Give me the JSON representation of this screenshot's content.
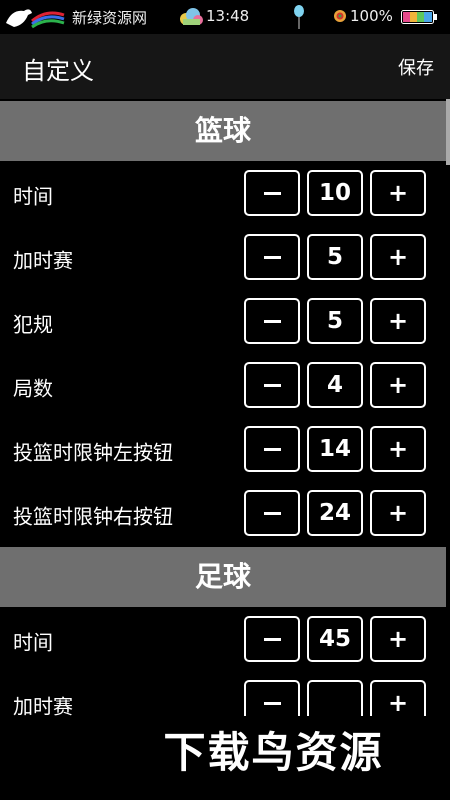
{
  "status_bar": {
    "site_name": "新绿资源网",
    "time": "13:48",
    "battery": "100%",
    "icons": [
      "horse-logo-icon",
      "cloud-icon",
      "balloon-icon",
      "target-icon",
      "battery-icon"
    ]
  },
  "app_bar": {
    "title": "自定义",
    "save_label": "保存"
  },
  "basketball": {
    "title": "篮球",
    "rows": [
      {
        "label": "时间",
        "value": "10"
      },
      {
        "label": "加时赛",
        "value": "5"
      },
      {
        "label": "犯规",
        "value": "5"
      },
      {
        "label": "局数",
        "value": "4"
      },
      {
        "label": "投篮时限钟左按钮",
        "value": "14"
      },
      {
        "label": "投篮时限钟右按钮",
        "value": "24"
      }
    ]
  },
  "football": {
    "title": "足球",
    "rows": [
      {
        "label": "时间",
        "value": "45"
      },
      {
        "label": "加时赛",
        "value": ""
      }
    ]
  },
  "controls": {
    "minus_icon": "minus-icon",
    "plus_symbol": "+"
  },
  "watermark": {
    "text": "下载鸟资源"
  },
  "colors": {
    "background": "#000000",
    "app_bar": "#161616",
    "section_header": "#6f6f6f",
    "text": "#ffffff"
  }
}
